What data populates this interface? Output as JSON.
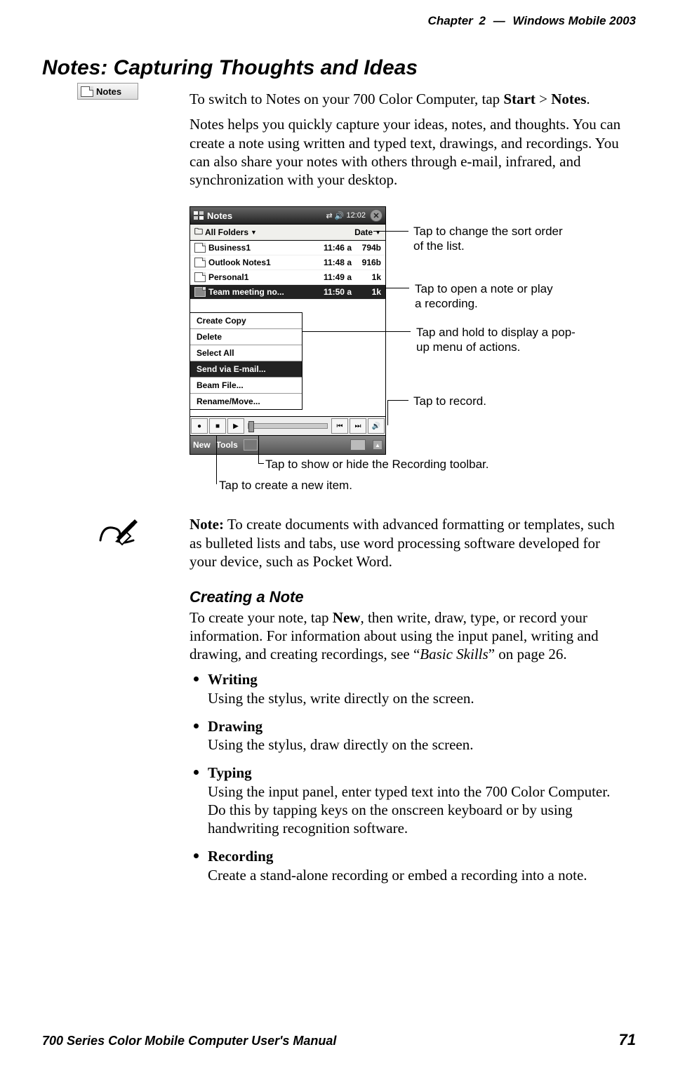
{
  "header": {
    "chapter_label": "Chapter",
    "chapter_num": "2",
    "dash": "—",
    "title": "Windows Mobile 2003"
  },
  "section": {
    "title": "Notes: Capturing Thoughts and Ideas"
  },
  "margin_chip": {
    "label": "Notes"
  },
  "intro": {
    "p1_a": "To switch to Notes on your 700 Color Computer, tap ",
    "p1_b": "Start",
    "p1_c": " > ",
    "p1_d": "Notes",
    "p1_e": ".",
    "p2": "Notes helps you quickly capture your ideas, notes, and thoughts. You can create a note using written and typed text, drawings, and recordings. You can also share your notes with others through e-mail, infrared, and synchronization with your desktop."
  },
  "screenshot": {
    "app_title": "Notes",
    "clock": "12:02",
    "folders_label": "All Folders",
    "sort_label": "Date",
    "rows": [
      {
        "name": "Business1",
        "time": "11:46 a",
        "size": "794b"
      },
      {
        "name": "Outlook Notes1",
        "time": "11:48 a",
        "size": "916b"
      },
      {
        "name": "Personal1",
        "time": "11:49 a",
        "size": "1k"
      },
      {
        "name": "Team meeting no...",
        "time": "11:50 a",
        "size": "1k"
      }
    ],
    "context_menu": [
      "Create Copy",
      "Delete",
      "Select All",
      "Send via E-mail...",
      "Beam File...",
      "Rename/Move..."
    ],
    "menu_new": "New",
    "menu_tools": "Tools"
  },
  "callouts": {
    "sort": "Tap to change the sort order of the list.",
    "open": "Tap to open a note or play a recording.",
    "hold": "Tap and hold to display a pop-up menu of actions.",
    "record": "Tap to record.",
    "showhide": "Tap to show or hide the Recording toolbar.",
    "newitem": "Tap to create a new item."
  },
  "note": {
    "lead": "Note:",
    "body": " To create documents with advanced formatting or templates, such as bulleted lists and tabs, use word processing software developed for your device, such as Pocket Word."
  },
  "creating": {
    "heading": "Creating a Note",
    "intro_a": "To create your note, tap ",
    "intro_b": "New",
    "intro_c": ", then write, draw, type, or record your information. For information about using the input panel, writing and drawing, and creating recordings, see “",
    "intro_d": "Basic Skills",
    "intro_e": "” on page 26.",
    "items": [
      {
        "name": "Writing",
        "desc": "Using the stylus, write directly on the screen."
      },
      {
        "name": "Drawing",
        "desc": "Using the stylus, draw directly on the screen."
      },
      {
        "name": "Typing",
        "desc": "Using the input panel, enter typed text into the 700 Color Computer. Do this by tapping keys on the onscreen keyboard or by using handwriting recognition software."
      },
      {
        "name": "Recording",
        "desc": "Create a stand-alone recording or embed a recording into a note."
      }
    ]
  },
  "footer": {
    "manual": "700 Series Color Mobile Computer User's Manual",
    "page": "71"
  }
}
